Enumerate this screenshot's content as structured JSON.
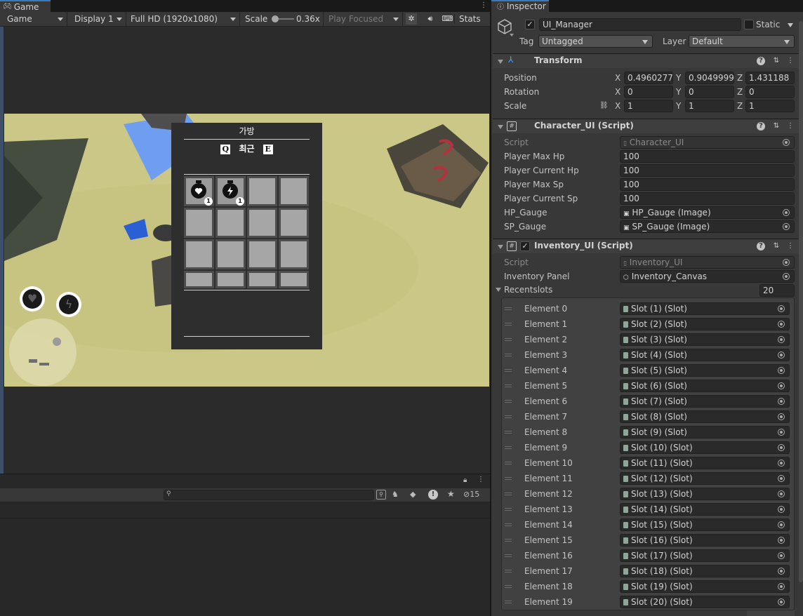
{
  "game": {
    "tab_label": "Game",
    "toolbar": {
      "mode": "Game",
      "display": "Display 1",
      "resolution": "Full HD (1920x1080)",
      "scale_label": "Scale",
      "scale_value": "0.36x",
      "play_mode": "Play Focused",
      "stats_label": "Stats"
    },
    "inventory": {
      "title": "가방",
      "key_left": "Q",
      "tab_label": "최근",
      "key_right": "E",
      "slots": [
        {
          "item": "heart-potion",
          "count": "1"
        },
        {
          "item": "lightning-potion",
          "count": "1"
        }
      ]
    }
  },
  "console": {
    "hidden_count": "15"
  },
  "inspector": {
    "tab_label": "Inspector",
    "object_name": "UI_Manager",
    "static_label": "Static",
    "tag_label": "Tag",
    "tag_value": "Untagged",
    "layer_label": "Layer",
    "layer_value": "Default",
    "transform": {
      "title": "Transform",
      "position_label": "Position",
      "rotation_label": "Rotation",
      "scale_label": "Scale",
      "position": {
        "x": "0.4960277",
        "y": "0.9049999",
        "z": "1.431188"
      },
      "rotation": {
        "x": "0",
        "y": "0",
        "z": "0"
      },
      "scale": {
        "x": "1",
        "y": "1",
        "z": "1"
      }
    },
    "character_ui": {
      "title": "Character_UI (Script)",
      "script_label": "Script",
      "script_value": "Character_UI",
      "fields": [
        {
          "label": "Player Max Hp",
          "value": "100"
        },
        {
          "label": "Player Current Hp",
          "value": "100"
        },
        {
          "label": "Player Max Sp",
          "value": "100"
        },
        {
          "label": "Player Current Sp",
          "value": "100"
        },
        {
          "label": "HP_Gauge",
          "value": "HP_Gauge (Image)"
        },
        {
          "label": "SP_Gauge",
          "value": "SP_Gauge (Image)"
        }
      ]
    },
    "inventory_ui": {
      "title": "Inventory_UI (Script)",
      "script_label": "Script",
      "script_value": "Inventory_UI",
      "panel_label": "Inventory Panel",
      "panel_value": "Inventory_Canvas",
      "recentslots_label": "Recentslots",
      "recentslots_count": "20",
      "elements": [
        {
          "label": "Element 0",
          "value": "Slot (1) (Slot)"
        },
        {
          "label": "Element 1",
          "value": "Slot (2) (Slot)"
        },
        {
          "label": "Element 2",
          "value": "Slot (3) (Slot)"
        },
        {
          "label": "Element 3",
          "value": "Slot (4) (Slot)"
        },
        {
          "label": "Element 4",
          "value": "Slot (5) (Slot)"
        },
        {
          "label": "Element 5",
          "value": "Slot (6) (Slot)"
        },
        {
          "label": "Element 6",
          "value": "Slot (7) (Slot)"
        },
        {
          "label": "Element 7",
          "value": "Slot (8) (Slot)"
        },
        {
          "label": "Element 8",
          "value": "Slot (9) (Slot)"
        },
        {
          "label": "Element 9",
          "value": "Slot (10) (Slot)"
        },
        {
          "label": "Element 10",
          "value": "Slot (11) (Slot)"
        },
        {
          "label": "Element 11",
          "value": "Slot (12) (Slot)"
        },
        {
          "label": "Element 12",
          "value": "Slot (13) (Slot)"
        },
        {
          "label": "Element 13",
          "value": "Slot (14) (Slot)"
        },
        {
          "label": "Element 14",
          "value": "Slot (15) (Slot)"
        },
        {
          "label": "Element 15",
          "value": "Slot (16) (Slot)"
        },
        {
          "label": "Element 16",
          "value": "Slot (17) (Slot)"
        },
        {
          "label": "Element 17",
          "value": "Slot (18) (Slot)"
        },
        {
          "label": "Element 18",
          "value": "Slot (19) (Slot)"
        },
        {
          "label": "Element 19",
          "value": "Slot (20) (Slot)"
        }
      ]
    }
  }
}
